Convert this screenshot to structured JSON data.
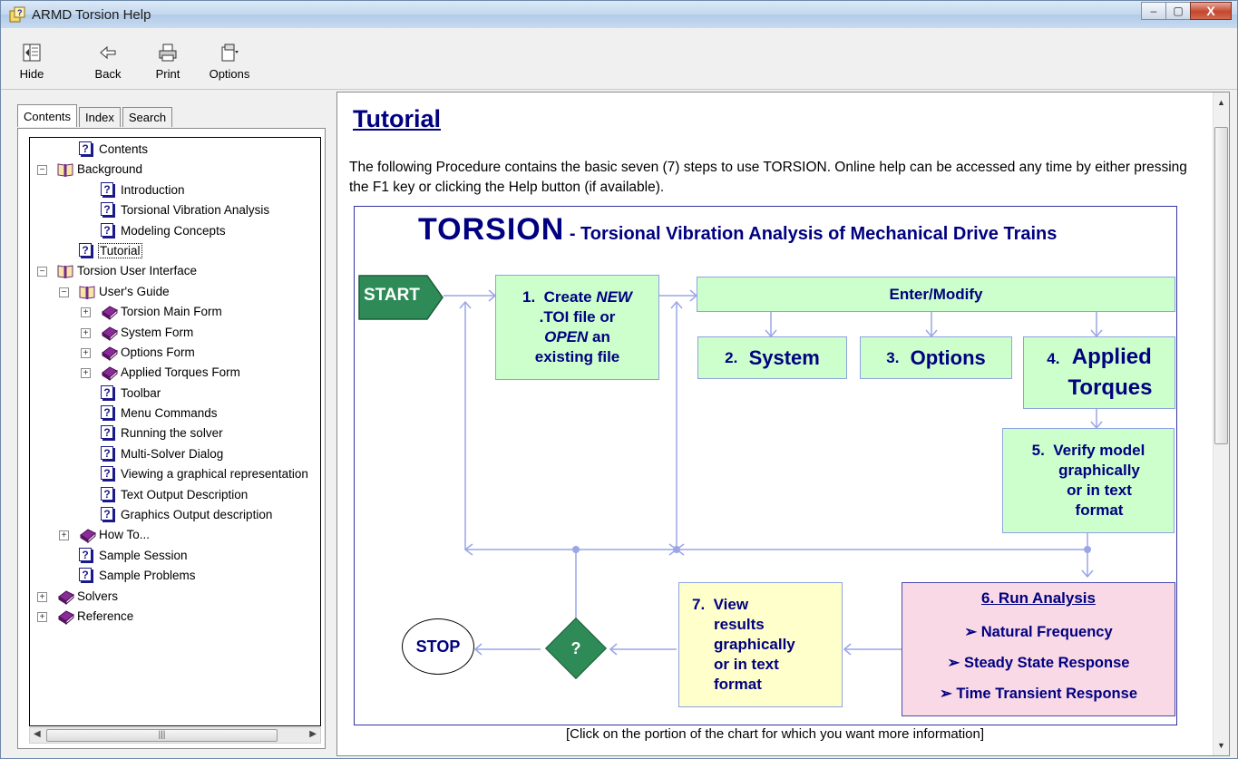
{
  "window": {
    "title": "ARMD Torsion Help",
    "controls": [
      "–",
      "▢",
      "X"
    ]
  },
  "toolbar": [
    {
      "label": "Hide",
      "icon": "hide-icon"
    },
    {
      "label": "Back",
      "icon": "back-arrow-icon"
    },
    {
      "label": "Print",
      "icon": "printer-icon"
    },
    {
      "label": "Options",
      "icon": "options-icon"
    }
  ],
  "nav": {
    "tabs": [
      "Contents",
      "Index",
      "Search"
    ],
    "tree": [
      {
        "label": "Contents",
        "type": "topic",
        "level": 1
      },
      {
        "label": "Background",
        "type": "book-open",
        "level": 0,
        "exp": "−"
      },
      {
        "label": "Introduction",
        "type": "topic",
        "level": 2
      },
      {
        "label": "Torsional Vibration Analysis",
        "type": "topic",
        "level": 2
      },
      {
        "label": "Modeling Concepts",
        "type": "topic",
        "level": 2
      },
      {
        "label": "Tutorial",
        "type": "topic",
        "level": 1,
        "selected": true
      },
      {
        "label": "Torsion User Interface",
        "type": "book-open",
        "level": 0,
        "exp": "−"
      },
      {
        "label": "User's Guide",
        "type": "book-open",
        "level": 1,
        "exp": "−"
      },
      {
        "label": "Torsion Main Form",
        "type": "book",
        "level": 2,
        "exp": "+"
      },
      {
        "label": "System Form",
        "type": "book",
        "level": 2,
        "exp": "+"
      },
      {
        "label": "Options Form",
        "type": "book",
        "level": 2,
        "exp": "+"
      },
      {
        "label": "Applied Torques Form",
        "type": "book",
        "level": 2,
        "exp": "+"
      },
      {
        "label": "Toolbar",
        "type": "topic",
        "level": 2
      },
      {
        "label": "Menu Commands",
        "type": "topic",
        "level": 2
      },
      {
        "label": "Running the solver",
        "type": "topic",
        "level": 2
      },
      {
        "label": "Multi-Solver Dialog",
        "type": "topic",
        "level": 2
      },
      {
        "label": "Viewing a graphical representation",
        "type": "topic",
        "level": 2
      },
      {
        "label": "Text Output Description",
        "type": "topic",
        "level": 2
      },
      {
        "label": "Graphics Output description",
        "type": "topic",
        "level": 2
      },
      {
        "label": "How To...",
        "type": "book",
        "level": 1,
        "exp": "+"
      },
      {
        "label": "Sample Session",
        "type": "topic",
        "level": 1
      },
      {
        "label": "Sample Problems",
        "type": "topic",
        "level": 1
      },
      {
        "label": "Solvers",
        "type": "book",
        "level": 0,
        "exp": "+"
      },
      {
        "label": "Reference",
        "type": "book",
        "level": 0,
        "exp": "+"
      }
    ]
  },
  "content": {
    "title": "Tutorial",
    "intro": "The following Procedure contains the basic seven (7) steps to use TORSION. Online help can be accessed any time by either pressing the F1 key or clicking the Help button (if available).",
    "caption": "[Click on the portion of the chart for which you want more information]",
    "flow": {
      "title_big": "TORSION",
      "title_small": " - Torsional Vibration Analysis of Mechanical Drive Trains",
      "start": "START",
      "stop": "STOP",
      "decision": "?",
      "step1": {
        "num": "1.",
        "text_a": "Create ",
        "text_b": "NEW",
        "text_c": ".TOI file or",
        "text_d": "OPEN",
        "text_e": " an",
        "text_f": "existing file"
      },
      "enter_modify": "Enter/Modify",
      "step2": {
        "num": "2.",
        "text": "System"
      },
      "step3": {
        "num": "3.",
        "text": "Options"
      },
      "step4": {
        "num": "4.",
        "text_a": "Applied",
        "text_b": "Torques"
      },
      "step5": {
        "num": "5.",
        "text_a": "Verify model",
        "text_b": "graphically",
        "text_c": "or in text",
        "text_d": "format"
      },
      "step6": {
        "title": "6.  Run Analysis",
        "items": [
          "➢ Natural Frequency",
          "➢ Steady State Response",
          "➢ Time Transient Response"
        ]
      },
      "step7": {
        "num": "7.",
        "text_a": "View",
        "text_b": "results",
        "text_c": "graphically",
        "text_d": "or in text",
        "text_e": "format"
      }
    }
  }
}
